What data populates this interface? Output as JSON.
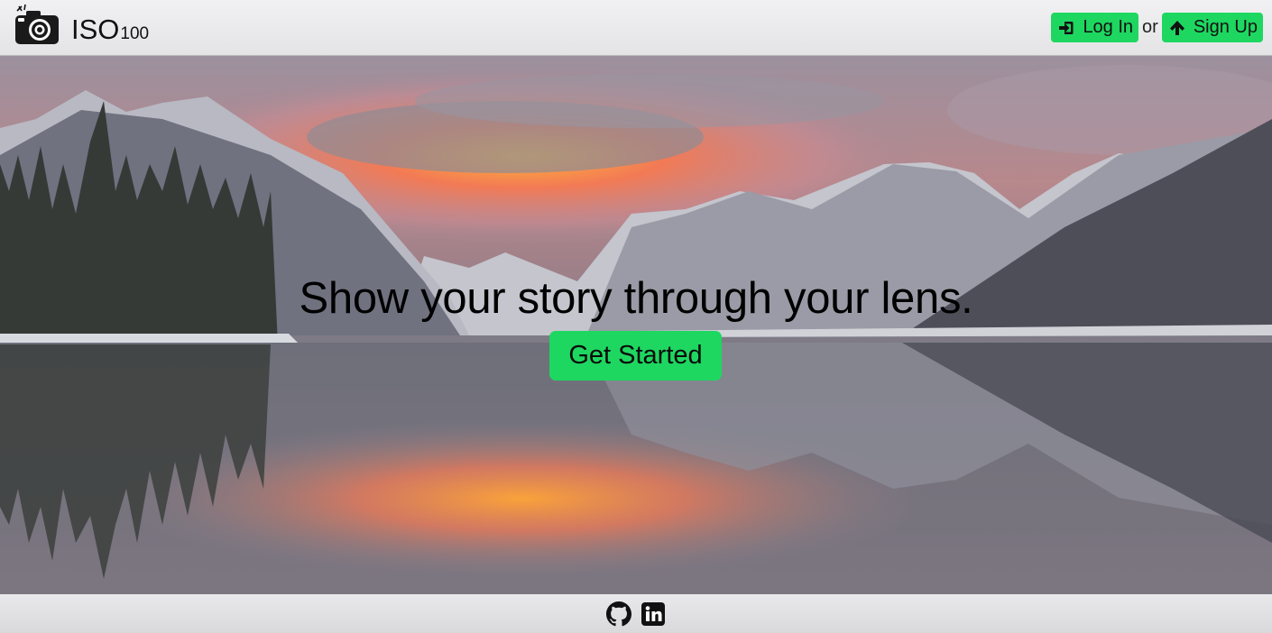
{
  "header": {
    "logo_text": "ISO",
    "logo_sub": "100",
    "login_label": "Log In",
    "or_text": "or",
    "signup_label": "Sign Up"
  },
  "hero": {
    "title": "Show your story through your lens.",
    "cta_label": "Get Started"
  },
  "footer": {
    "links": [
      "github-icon",
      "linkedin-icon"
    ]
  },
  "colors": {
    "accent": "#1ed760",
    "header_bg": "#eeeef0",
    "footer_bg": "#e3e3e5"
  }
}
